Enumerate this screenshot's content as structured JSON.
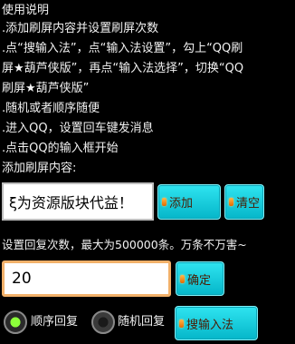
{
  "instructions": {
    "title": "使用说明",
    "lines": [
      ".添加刷屏内容并设置刷屏次数",
      ".点“搜输入法”，点“输入法设置”，勾上“QQ刷",
      "屏★葫芦侠版”，再点“输入法选择”，切换“QQ",
      "刷屏★葫芦侠版”",
      ".随机或者顺序随便",
      ".进入QQ，设置回车键发消息",
      ".点击QQ的输入框开始"
    ]
  },
  "add_section": {
    "label": "添加刷屏内容:",
    "content_value": "ξ为资源版块代益！",
    "add_button": "添加",
    "clear_button": "清空"
  },
  "count_section": {
    "label": "设置回复次数，最大为500000条。万条不万害~",
    "count_value": "20",
    "confirm_button": "确定"
  },
  "mode_section": {
    "order_label": "顺序回复",
    "random_label": "随机回复",
    "order_selected": true,
    "search_button": "搜输入法"
  }
}
